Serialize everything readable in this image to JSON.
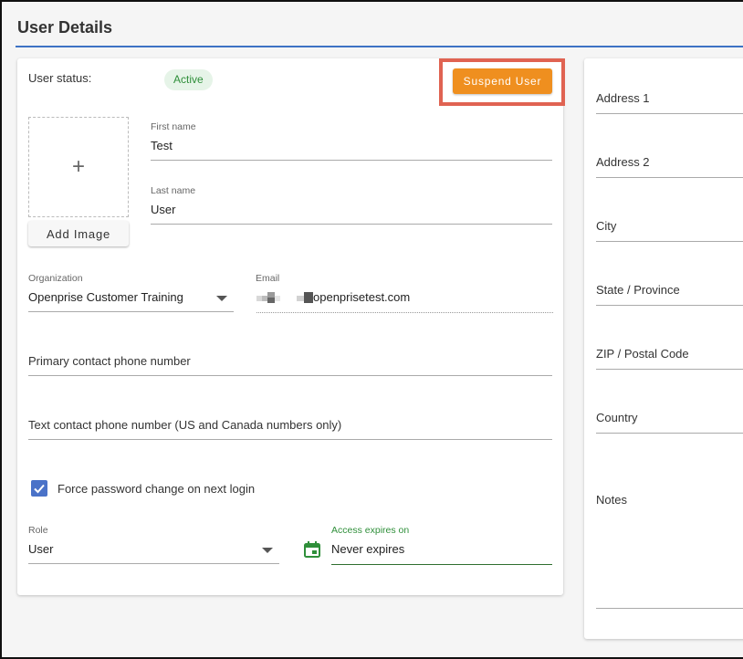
{
  "page": {
    "title": "User Details"
  },
  "status": {
    "label": "User status:",
    "value": "Active"
  },
  "actions": {
    "suspend_label": "Suspend User",
    "add_image_label": "Add Image"
  },
  "image_placeholder": {
    "glyph": "+"
  },
  "form": {
    "first_name": {
      "label": "First name",
      "value": "Test"
    },
    "last_name": {
      "label": "Last name",
      "value": "User"
    },
    "organization": {
      "label": "Organization",
      "value": "Openprise Customer Training"
    },
    "email": {
      "label": "Email",
      "value_visible": "openprisetest.com"
    },
    "primary_phone": {
      "placeholder": "Primary contact phone number"
    },
    "text_phone": {
      "placeholder": "Text contact phone number (US and Canada numbers only)"
    },
    "force_password": {
      "label": "Force password change on next login",
      "checked": true
    },
    "role": {
      "label": "Role",
      "value": "User"
    },
    "access_expires": {
      "label": "Access expires on",
      "value": "Never expires"
    }
  },
  "address": {
    "address1": "Address 1",
    "address2": "Address 2",
    "city": "City",
    "state": "State / Province",
    "zip": "ZIP / Postal Code",
    "country": "Country",
    "notes": "Notes"
  },
  "colors": {
    "accent_blue": "#3d72c4",
    "suspend_orange": "#ef8f1f",
    "highlight_red": "#e06352",
    "active_green": "#2f8f3a",
    "checkbox_blue": "#4a72c8"
  },
  "icons": [
    "plus-icon",
    "chevron-down-icon",
    "checkbox-checked-icon",
    "calendar-icon"
  ]
}
